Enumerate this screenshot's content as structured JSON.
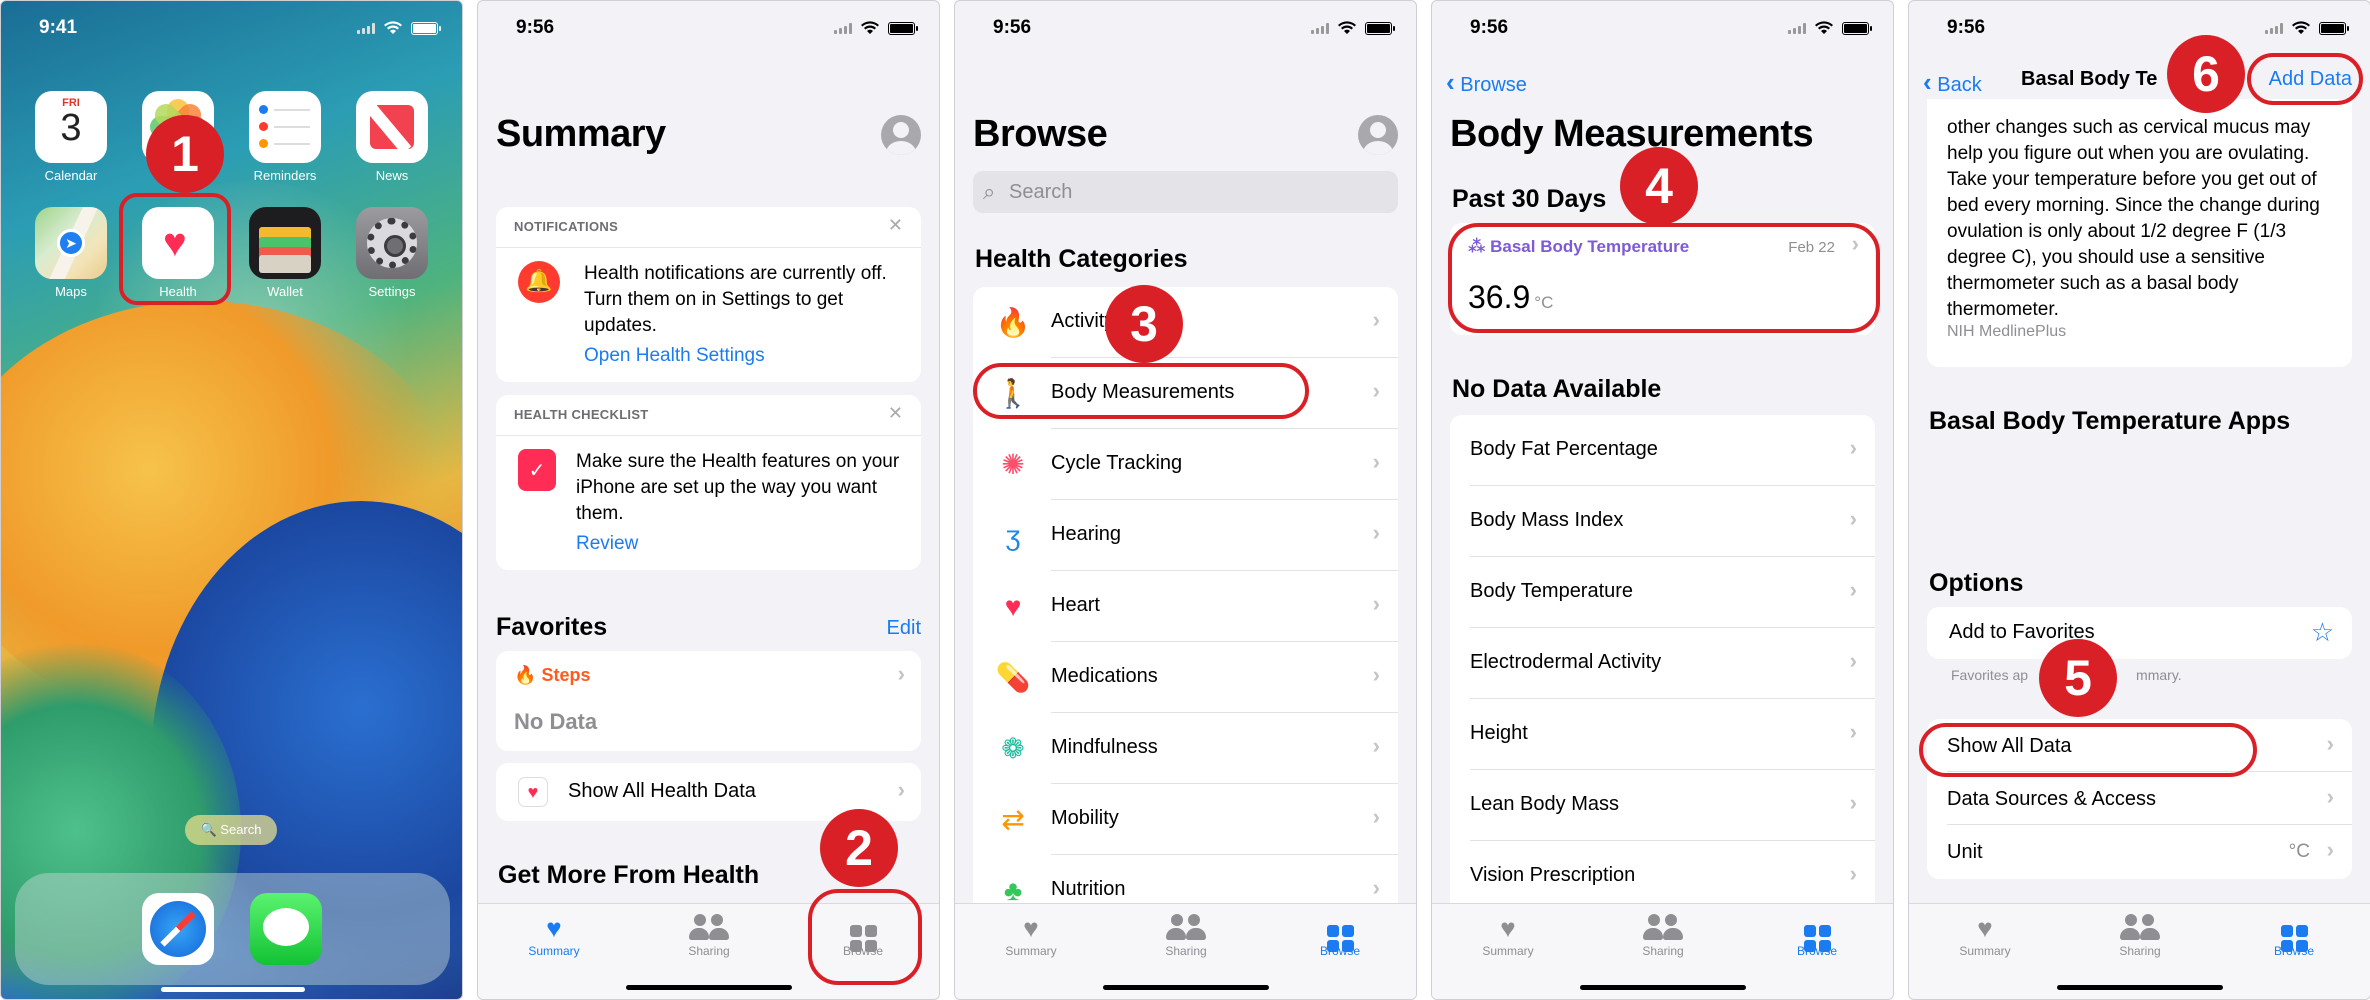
{
  "screens": {
    "home": {
      "time": "9:41",
      "apps": [
        {
          "label": "Calendar",
          "day": "FRI",
          "date": "3",
          "icon": "calendar-icon"
        },
        {
          "label": "",
          "icon": "photos-icon"
        },
        {
          "label": "Reminders",
          "icon": "reminders-icon"
        },
        {
          "label": "News",
          "icon": "news-icon"
        },
        {
          "label": "Maps",
          "icon": "maps-icon"
        },
        {
          "label": "Health",
          "icon": "health-icon"
        },
        {
          "label": "Wallet",
          "icon": "wallet-icon"
        },
        {
          "label": "Settings",
          "icon": "settings-icon"
        }
      ],
      "search_label": "🔍 Search",
      "dock": [
        "safari-icon",
        "messages-icon"
      ]
    },
    "summary": {
      "time": "9:56",
      "title": "Summary",
      "notifications": {
        "heading": "NOTIFICATIONS",
        "text": "Health notifications are currently off. Turn them on in Settings to get updates.",
        "link": "Open Health Settings"
      },
      "checklist": {
        "heading": "HEALTH CHECKLIST",
        "text": "Make sure the Health features on your iPhone are set up the way you want them.",
        "link": "Review"
      },
      "favorites": {
        "heading": "Favorites",
        "edit": "Edit",
        "steps_label": "Steps",
        "steps_value": "No Data",
        "show_all": "Show All Health Data"
      },
      "get_more": "Get More From Health"
    },
    "browse": {
      "time": "9:56",
      "title": "Browse",
      "search_placeholder": "Search",
      "categories_heading": "Health Categories",
      "categories": [
        {
          "label": "Activity",
          "icon": "flame-icon",
          "color": "#ff5a1f"
        },
        {
          "label": "Body Measurements",
          "icon": "figure-icon",
          "color": "#8e44d8"
        },
        {
          "label": "Cycle Tracking",
          "icon": "cycle-icon",
          "color": "#ff4e6c"
        },
        {
          "label": "Hearing",
          "icon": "ear-icon",
          "color": "#1e88e5"
        },
        {
          "label": "Heart",
          "icon": "heart-icon",
          "color": "#ff2d55"
        },
        {
          "label": "Medications",
          "icon": "pills-icon",
          "color": "#26a8e8"
        },
        {
          "label": "Mindfulness",
          "icon": "mindfulness-icon",
          "color": "#1abc9c"
        },
        {
          "label": "Mobility",
          "icon": "mobility-icon",
          "color": "#ff9500"
        },
        {
          "label": "Nutrition",
          "icon": "apple-icon",
          "color": "#34c759"
        }
      ]
    },
    "body_measurements": {
      "time": "9:56",
      "back": "Browse",
      "title": "Body Measurements",
      "past_heading": "Past 30 Days",
      "recent": {
        "label": "Basal Body Temperature",
        "date": "Feb 22",
        "value": "36.9",
        "unit": "°C"
      },
      "no_data_heading": "No Data Available",
      "no_data": [
        "Body Fat Percentage",
        "Body Mass Index",
        "Body Temperature",
        "Electrodermal Activity",
        "Height",
        "Lean Body Mass",
        "Vision Prescription"
      ]
    },
    "detail": {
      "time": "9:56",
      "back": "Back",
      "title": "Basal Body Te",
      "add": "Add Data",
      "about_text": "other changes such as cervical mucus may help you figure out when you are ovulating. Take your temperature before you get out of bed every morning. Since the change during ovulation is only about 1/2 degree F (1/3 degree C), you should use a sensitive thermometer such as a basal body thermometer.",
      "source": "NIH MedlinePlus",
      "apps_heading": "Basal Body Temperature Apps",
      "options_heading": "Options",
      "add_fav": "Add to Favorites",
      "fav_note_a": "Favorites ap",
      "fav_note_b": "mmary.",
      "show_all": "Show All Data",
      "sources": "Data Sources & Access",
      "unit_label": "Unit",
      "unit_value": "°C"
    }
  },
  "tabs": [
    "Summary",
    "Sharing",
    "Browse"
  ],
  "callouts": [
    "1",
    "2",
    "3",
    "4",
    "5",
    "6"
  ],
  "colors": {
    "accent": "#1a7cf0",
    "callout": "#d92027"
  }
}
